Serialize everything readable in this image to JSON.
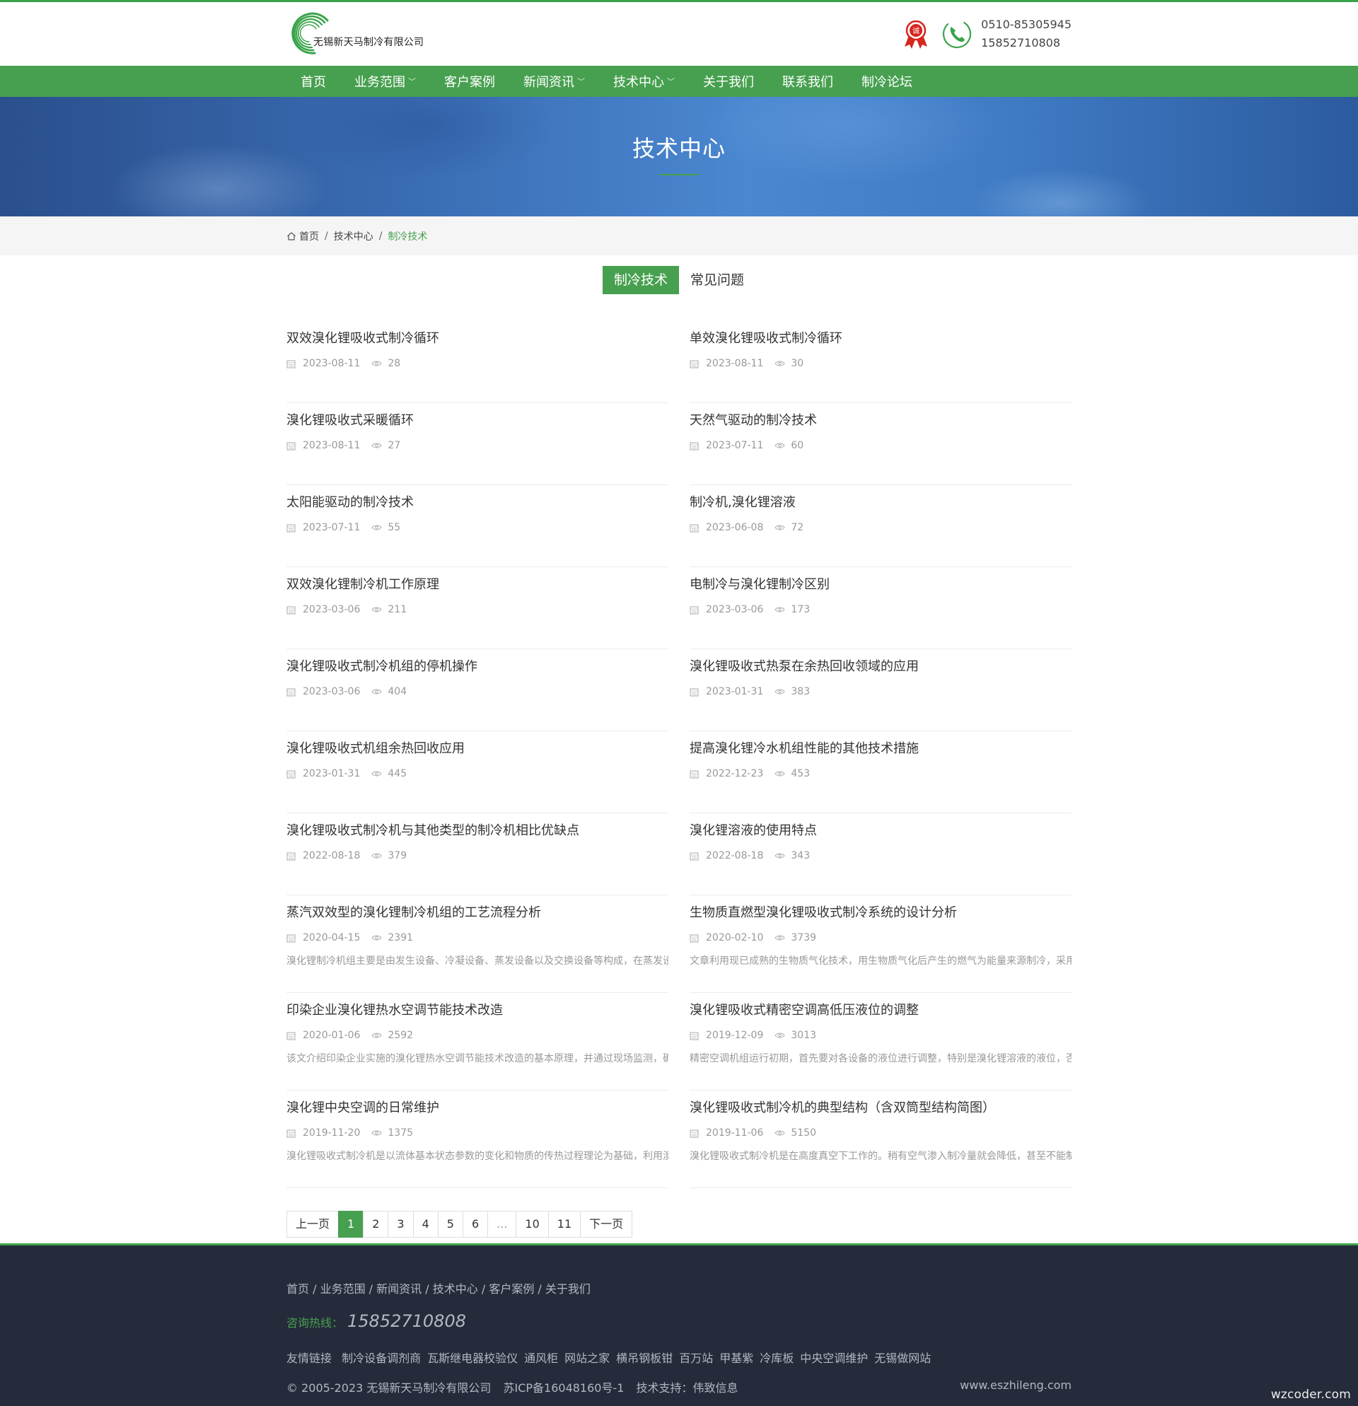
{
  "header": {
    "logo_text": "无锡新天马制冷有限公司",
    "phone1": "0510-85305945",
    "phone2": "15852710808",
    "award_char": "诚"
  },
  "nav": {
    "items": [
      {
        "label": "首页",
        "dropdown": false
      },
      {
        "label": "业务范围",
        "dropdown": true
      },
      {
        "label": "客户案例",
        "dropdown": false
      },
      {
        "label": "新闻资讯",
        "dropdown": true
      },
      {
        "label": "技术中心",
        "dropdown": true
      },
      {
        "label": "关于我们",
        "dropdown": false
      },
      {
        "label": "联系我们",
        "dropdown": false
      },
      {
        "label": "制冷论坛",
        "dropdown": false
      }
    ]
  },
  "banner": {
    "title": "技术中心"
  },
  "breadcrumb": {
    "home": "首页",
    "level2": "技术中心",
    "current": "制冷技术",
    "separator": "/"
  },
  "tabs": [
    {
      "label": "制冷技术",
      "active": true
    },
    {
      "label": "常见问题",
      "active": false
    }
  ],
  "articles": [
    {
      "title": "双效溴化锂吸收式制冷循环",
      "date": "2023-08-11",
      "views": "28"
    },
    {
      "title": "单效溴化锂吸收式制冷循环",
      "date": "2023-08-11",
      "views": "30"
    },
    {
      "title": "溴化锂吸收式采暖循环",
      "date": "2023-08-11",
      "views": "27"
    },
    {
      "title": "天然气驱动的制冷技术",
      "date": "2023-07-11",
      "views": "60"
    },
    {
      "title": "太阳能驱动的制冷技术",
      "date": "2023-07-11",
      "views": "55"
    },
    {
      "title": "制冷机,溴化锂溶液",
      "date": "2023-06-08",
      "views": "72"
    },
    {
      "title": "双效溴化锂制冷机工作原理",
      "date": "2023-03-06",
      "views": "211"
    },
    {
      "title": "电制冷与溴化锂制冷区别",
      "date": "2023-03-06",
      "views": "173"
    },
    {
      "title": "溴化锂吸收式制冷机组的停机操作",
      "date": "2023-03-06",
      "views": "404"
    },
    {
      "title": "溴化锂吸收式热泵在余热回收领域的应用",
      "date": "2023-01-31",
      "views": "383"
    },
    {
      "title": "溴化锂吸收式机组余热回收应用",
      "date": "2023-01-31",
      "views": "445"
    },
    {
      "title": "提高溴化锂冷水机组性能的其他技术措施",
      "date": "2022-12-23",
      "views": "453"
    },
    {
      "title": "溴化锂吸收式制冷机与其他类型的制冷机相比优缺点",
      "date": "2022-08-18",
      "views": "379"
    },
    {
      "title": "溴化锂溶液的使用特点",
      "date": "2022-08-18",
      "views": "343"
    },
    {
      "title": "蒸汽双效型的溴化锂制冷机组的工艺流程分析",
      "date": "2020-04-15",
      "views": "2391",
      "desc": "溴化锂制冷机组主要是由发生设备、冷凝设备、蒸发设备以及交换设备等构成，在蒸发设"
    },
    {
      "title": "生物质直燃型溴化锂吸收式制冷系统的设计分析",
      "date": "2020-02-10",
      "views": "3739",
      "desc": "文章利用现已成熟的生物质气化技术，用生物质气化后产生的燃气为能量来源制冷，采用"
    },
    {
      "title": "印染企业溴化锂热水空调节能技术改造",
      "date": "2020-01-06",
      "views": "2592",
      "desc": "该文介绍印染企业实施的溴化锂热水空调节能技术改造的基本原理，并通过现场监测，确"
    },
    {
      "title": "溴化锂吸收式精密空调高低压液位的调整",
      "date": "2019-12-09",
      "views": "3013",
      "desc": "精密空调机组运行初期，首先要对各设备的液位进行调整，特别是溴化锂溶液的液位，否"
    },
    {
      "title": "溴化锂中央空调的日常维护",
      "date": "2019-11-20",
      "views": "1375",
      "desc": "溴化锂吸收式制冷机是以流体基本状态参数的变化和物质的传热过程理论为基础，利用溴"
    },
    {
      "title": "溴化锂吸收式制冷机的典型结构（含双筒型结构简图）",
      "date": "2019-11-06",
      "views": "5150",
      "desc": "溴化锂吸收式制冷机是在高度真空下工作的。稍有空气渗入制冷量就会降低，甚至不能制"
    }
  ],
  "pagination": {
    "prev": "上一页",
    "pages": [
      "1",
      "2",
      "3",
      "4",
      "5",
      "6",
      "...",
      "10",
      "11"
    ],
    "current": "1",
    "next": "下一页"
  },
  "footer": {
    "links": [
      "首页",
      "业务范围",
      "新闻资讯",
      "技术中心",
      "客户案例",
      "关于我们"
    ],
    "link_sep": " / ",
    "hotline_label": "咨询热线：",
    "hotline_number": "15852710808",
    "friends_label": "友情链接",
    "friends": [
      "制冷设备调剂商",
      "瓦斯继电器校验仪",
      "通风柜",
      "网站之家",
      "横吊钢板钳",
      "百万站",
      "甲基紫",
      "冷库板",
      "中央空调维护",
      "无锡做网站"
    ],
    "copyright": "© 2005-2023 无锡新天马制冷有限公司",
    "icp": "苏ICP备16048160号-1",
    "support": "技术支持：伟致信息",
    "site": "www.eszhileng.com"
  },
  "watermark": "wzcoder.com",
  "colors": {
    "brand_green": "#47a04f",
    "footer_bg": "#262b3b"
  }
}
